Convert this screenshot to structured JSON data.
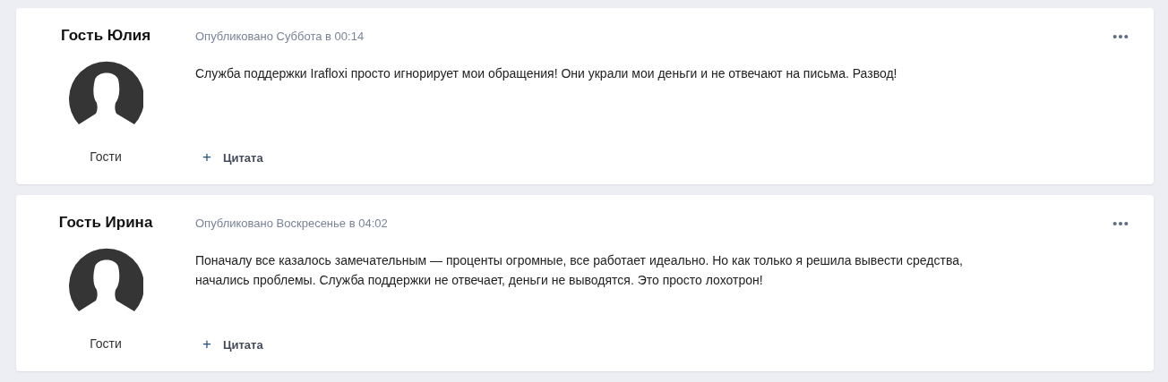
{
  "posts": [
    {
      "author": "Гость Юлия",
      "role": "Гости",
      "published": "Опубликовано Суббота в 00:14",
      "text": "Служба поддержки Irafloxi просто игнорирует мои обращения! Они украли мои деньги и не отвечают на письма. Развод!",
      "quote_icon": "+",
      "quote_label": "Цитата"
    },
    {
      "author": "Гость Ирина",
      "role": "Гости",
      "published": "Опубликовано Воскресенье в 04:02",
      "text": "Поначалу все казалось замечательным — проценты огромные, все работает идеально. Но как только я решила вывести средства, начались проблемы. Служба поддержки не отвечает, деньги не выводятся. Это просто лохотрон!",
      "quote_icon": "+",
      "quote_label": "Цитата"
    }
  ]
}
